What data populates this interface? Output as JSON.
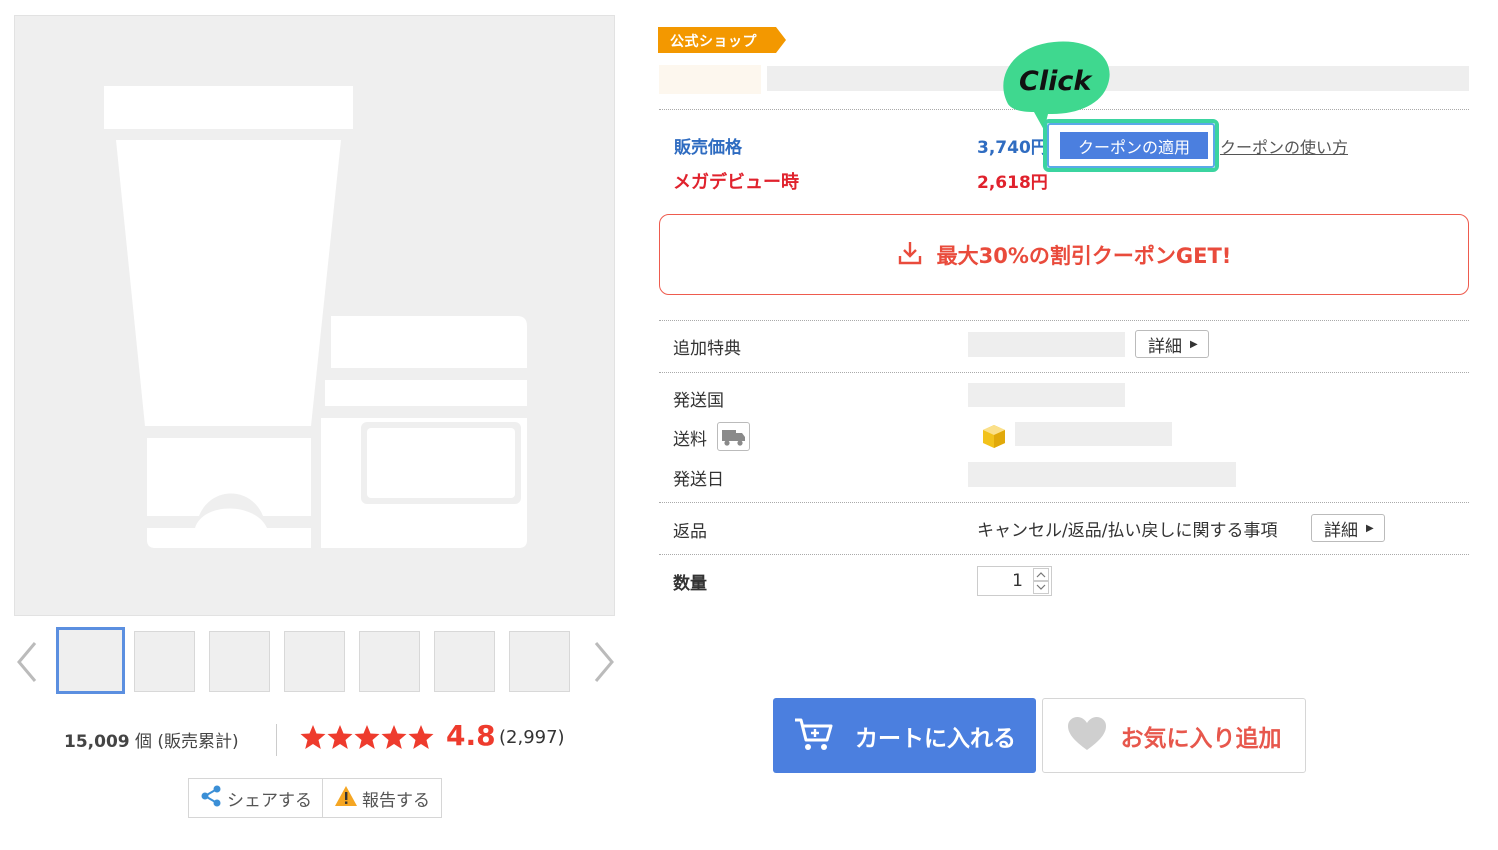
{
  "badge": {
    "text": "公式ショップ"
  },
  "price": {
    "label": "販売価格",
    "value": "3,740円",
    "mega_label": "メガデビュー時",
    "mega_value": "2,618円"
  },
  "coupon": {
    "apply_label": "クーポンの適用",
    "howto_label": "クーポンの使い方",
    "click_text": "Click",
    "get_label": "最大30%の割引クーポンGET!"
  },
  "details": {
    "bonus_label": "追加特典",
    "detail_button": "詳細",
    "ship_country_label": "発送国",
    "shipping_fee_label": "送料",
    "ship_date_label": "発送日",
    "return_label": "返品",
    "return_text": "キャンセル/返品/払い戻しに関する事項",
    "quantity_label": "数量",
    "quantity_value": "1"
  },
  "stats": {
    "sales_number": "15,009",
    "sales_suffix": " 個 (販売累計)",
    "rating": "4.8",
    "review_count": "(2,997)",
    "stars": 5
  },
  "actions": {
    "share": "シェアする",
    "report": "報告する"
  },
  "cta": {
    "cart": "カートに入れる",
    "favorite": "お気に入り追加"
  },
  "colors": {
    "accent_blue": "#4b7fdf",
    "price_blue": "#2f6cc1",
    "sale_red": "#e0222d",
    "coupon_red": "#e94b3c",
    "badge_orange": "#f39800",
    "highlight_green": "#3bd4a0"
  }
}
